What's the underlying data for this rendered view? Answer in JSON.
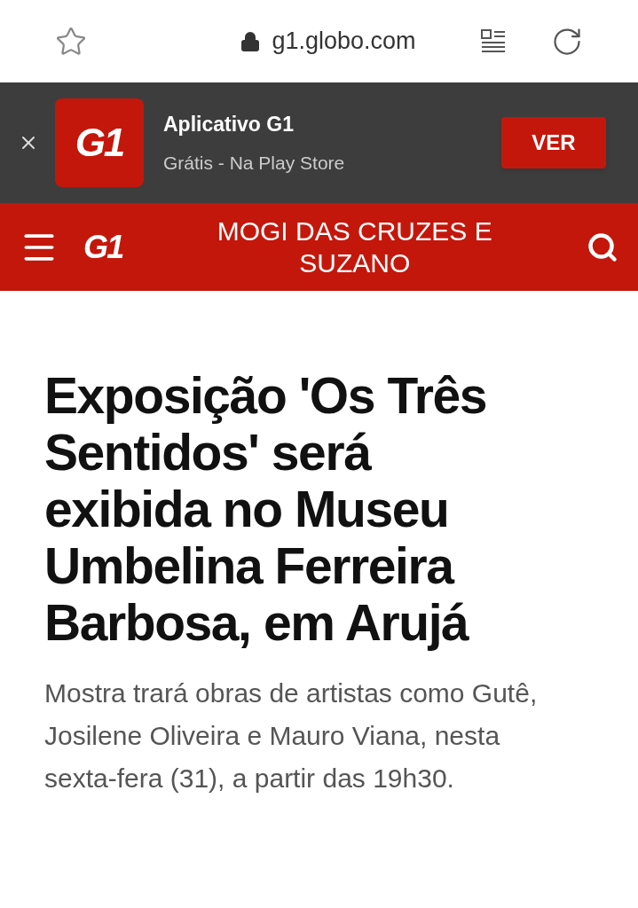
{
  "browser": {
    "url": "g1.globo.com"
  },
  "app_banner": {
    "logo": "G1",
    "title": "Aplicativo G1",
    "subtitle": "Grátis - Na Play Store",
    "button": "VER"
  },
  "header": {
    "logo": "G1",
    "section": "MOGI DAS CRUZES E SUZANO"
  },
  "article": {
    "headline": "Exposição 'Os Três Sentidos' será exibida no Museu Umbelina Ferreira Barbosa, em Arujá",
    "summary": "Mostra trará obras de artistas como Gutê, Josilene Oliveira e Mauro Viana, nesta sexta-fera (31), a partir das 19h30."
  }
}
